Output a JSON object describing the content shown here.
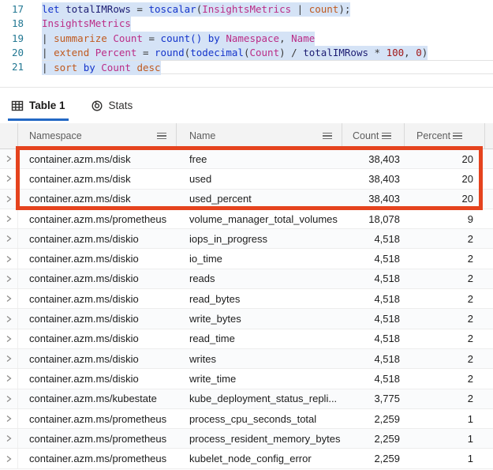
{
  "editor": {
    "lines": [
      {
        "number": "17",
        "tokens": [
          {
            "t": "let ",
            "c": "kw"
          },
          {
            "t": "totalIMRows ",
            "c": "var"
          },
          {
            "t": "= ",
            "c": "pun"
          },
          {
            "t": "toscalar",
            "c": "fn"
          },
          {
            "t": "(",
            "c": "pun"
          },
          {
            "t": "InsightsMetrics",
            "c": "tbl"
          },
          {
            "t": " | ",
            "c": "pun"
          },
          {
            "t": "count",
            "c": "op"
          },
          {
            "t": ");",
            "c": "pun"
          }
        ]
      },
      {
        "number": "18",
        "tokens": [
          {
            "t": "InsightsMetrics",
            "c": "tbl"
          }
        ]
      },
      {
        "number": "19",
        "tokens": [
          {
            "t": "| ",
            "c": "pun"
          },
          {
            "t": "summarize ",
            "c": "op"
          },
          {
            "t": "Count ",
            "c": "tbl"
          },
          {
            "t": "= ",
            "c": "pun"
          },
          {
            "t": "count() ",
            "c": "fn"
          },
          {
            "t": "by ",
            "c": "kw"
          },
          {
            "t": "Namespace",
            "c": "tbl"
          },
          {
            "t": ", ",
            "c": "pun"
          },
          {
            "t": "Name",
            "c": "tbl"
          }
        ]
      },
      {
        "number": "20",
        "tokens": [
          {
            "t": "| ",
            "c": "pun"
          },
          {
            "t": "extend ",
            "c": "op"
          },
          {
            "t": "Percent ",
            "c": "tbl"
          },
          {
            "t": "= ",
            "c": "pun"
          },
          {
            "t": "round",
            "c": "fn"
          },
          {
            "t": "(",
            "c": "pun"
          },
          {
            "t": "todecimal",
            "c": "fn"
          },
          {
            "t": "(",
            "c": "pun"
          },
          {
            "t": "Count",
            "c": "tbl"
          },
          {
            "t": ") / ",
            "c": "pun"
          },
          {
            "t": "totalIMRows",
            "c": "var"
          },
          {
            "t": " * ",
            "c": "pun"
          },
          {
            "t": "100",
            "c": "num"
          },
          {
            "t": ", ",
            "c": "pun"
          },
          {
            "t": "0",
            "c": "num"
          },
          {
            "t": ")",
            "c": "pun"
          }
        ]
      },
      {
        "number": "21",
        "current": true,
        "tokens": [
          {
            "t": "| ",
            "c": "pun"
          },
          {
            "t": "sort ",
            "c": "op"
          },
          {
            "t": "by ",
            "c": "kw"
          },
          {
            "t": "Count ",
            "c": "tbl"
          },
          {
            "t": "desc",
            "c": "op"
          }
        ]
      }
    ],
    "selection_color": "#d5e3f6"
  },
  "tabs": {
    "table_tab_label": "Table 1",
    "stats_tab_label": "Stats",
    "active_tab": "Table 1",
    "underline_color": "#2368c4",
    "icons": {
      "table_tab": "table-grid-icon",
      "stats_tab": "donut-chart-icon"
    }
  },
  "table": {
    "columns": {
      "namespace": "Namespace",
      "name": "Name",
      "count": "Count",
      "percent": "Percent"
    },
    "column_menu_icon": "menu-icon",
    "row_expand_icon": "chevron-right-icon",
    "rows": [
      {
        "namespace": "container.azm.ms/disk",
        "name": "free",
        "count": "38,403",
        "percent": "20"
      },
      {
        "namespace": "container.azm.ms/disk",
        "name": "used",
        "count": "38,403",
        "percent": "20"
      },
      {
        "namespace": "container.azm.ms/disk",
        "name": "used_percent",
        "count": "38,403",
        "percent": "20"
      },
      {
        "namespace": "container.azm.ms/prometheus",
        "name": "volume_manager_total_volumes",
        "count": "18,078",
        "percent": "9"
      },
      {
        "namespace": "container.azm.ms/diskio",
        "name": "iops_in_progress",
        "count": "4,518",
        "percent": "2"
      },
      {
        "namespace": "container.azm.ms/diskio",
        "name": "io_time",
        "count": "4,518",
        "percent": "2"
      },
      {
        "namespace": "container.azm.ms/diskio",
        "name": "reads",
        "count": "4,518",
        "percent": "2"
      },
      {
        "namespace": "container.azm.ms/diskio",
        "name": "read_bytes",
        "count": "4,518",
        "percent": "2"
      },
      {
        "namespace": "container.azm.ms/diskio",
        "name": "write_bytes",
        "count": "4,518",
        "percent": "2"
      },
      {
        "namespace": "container.azm.ms/diskio",
        "name": "read_time",
        "count": "4,518",
        "percent": "2"
      },
      {
        "namespace": "container.azm.ms/diskio",
        "name": "writes",
        "count": "4,518",
        "percent": "2"
      },
      {
        "namespace": "container.azm.ms/diskio",
        "name": "write_time",
        "count": "4,518",
        "percent": "2"
      },
      {
        "namespace": "container.azm.ms/kubestate",
        "name": "kube_deployment_status_repli...",
        "count": "3,775",
        "percent": "2"
      },
      {
        "namespace": "container.azm.ms/prometheus",
        "name": "process_cpu_seconds_total",
        "count": "2,259",
        "percent": "1"
      },
      {
        "namespace": "container.azm.ms/prometheus",
        "name": "process_resident_memory_bytes",
        "count": "2,259",
        "percent": "1"
      },
      {
        "namespace": "container.azm.ms/prometheus",
        "name": "kubelet_node_config_error",
        "count": "2,259",
        "percent": "1"
      }
    ],
    "highlighted_row_indexes": [
      0,
      1,
      2
    ],
    "highlight_border_color": "#e5431e"
  }
}
